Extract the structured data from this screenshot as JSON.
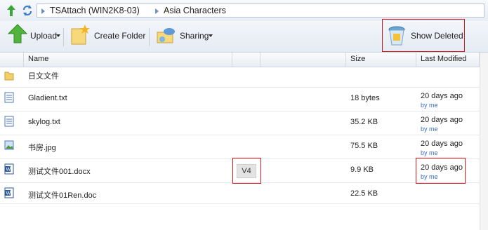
{
  "breadcrumb": {
    "items": [
      "TSAttach (WIN2K8-03)",
      "Asia Characters"
    ]
  },
  "toolbar": {
    "upload_label": "Upload",
    "create_folder_label": "Create Folder",
    "sharing_label": "Sharing",
    "show_deleted_label": "Show Deleted"
  },
  "columns": {
    "name": "Name",
    "size": "Size",
    "last_modified": "Last Modified"
  },
  "files": [
    {
      "name": "日文文件",
      "type": "folder",
      "size": "",
      "date": "",
      "by": ""
    },
    {
      "name": "Gladient.txt",
      "type": "text",
      "size": "18 bytes",
      "date": "20 days ago",
      "by": "by me"
    },
    {
      "name": "skylog.txt",
      "type": "text",
      "size": "35.2 KB",
      "date": "20 days ago",
      "by": "by me"
    },
    {
      "name": "书房.jpg",
      "type": "image",
      "size": "75.5 KB",
      "date": "20 days ago",
      "by": "by me"
    },
    {
      "name": "测试文件001.docx",
      "type": "word",
      "size": "9.9 KB",
      "date": "20 days ago",
      "by": "by me",
      "version": "V4"
    },
    {
      "name": "测试文件01Ren.doc",
      "type": "word",
      "size": "22.5 KB",
      "date": "",
      "by": ""
    }
  ],
  "colors": {
    "highlight_border": "#d8181a",
    "link": "#3b6dbf"
  }
}
